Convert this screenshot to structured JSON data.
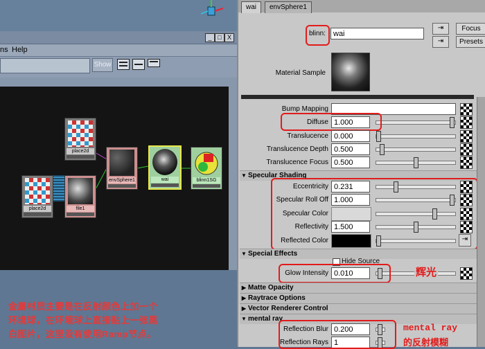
{
  "hypershade": {
    "menu_help": "Help",
    "menu_partial": "ns",
    "show_label": "Show",
    "title_buttons": [
      "_",
      "□",
      "X"
    ],
    "nodes": [
      {
        "key": "place2d_top",
        "label": "place2d"
      },
      {
        "key": "place2d_bottom",
        "label": "place2d"
      },
      {
        "key": "file1",
        "label": "file1"
      },
      {
        "key": "envSphere1",
        "label": "envSphere1"
      },
      {
        "key": "wai",
        "label": "wai"
      },
      {
        "key": "blinnSG",
        "label": "blinn1SG"
      }
    ],
    "note_line1": "金屬材质主要是在反射颜色上加一个",
    "note_line2": "环境球，在环境球上直接贴上一张黑",
    "note_line3": "白图片，这里没有使用Ramp节点。"
  },
  "attribute_editor": {
    "tabs": [
      "wai",
      "envSphere1"
    ],
    "type_label": "blinn:",
    "name_value": "wai",
    "focus_label": "Focus",
    "presets_label": "Presets",
    "material_sample_label": "Material Sample",
    "rows_top": [
      {
        "label": "Bump Mapping",
        "value": "",
        "slider": null
      },
      {
        "label": "Diffuse",
        "value": "1.000",
        "slider": 0.98
      },
      {
        "label": "Translucence",
        "value": "0.000",
        "slider": 0.0
      },
      {
        "label": "Translucence Depth",
        "value": "0.500",
        "slider": 0.05
      },
      {
        "label": "Translucence Focus",
        "value": "0.500",
        "slider": 0.5
      }
    ],
    "section_specular": "Specular Shading",
    "rows_specular": [
      {
        "label": "Eccentricity",
        "value": "0.231",
        "slider": 0.23
      },
      {
        "label": "Specular Roll Off",
        "value": "1.000",
        "slider": 0.98
      },
      {
        "label": "Specular Color",
        "value": "",
        "slider": 0.75
      },
      {
        "label": "Reflectivity",
        "value": "1.500",
        "slider": 0.5
      },
      {
        "label": "Reflected Color",
        "value": "",
        "slider": 0.0
      }
    ],
    "section_special": "Special Effects",
    "hide_source_label": "Hide Source",
    "glow_label": "Glow Intensity",
    "glow_value": "0.010",
    "glow_note": "辉光",
    "sections_collapsed": [
      "Matte Opacity",
      "Raytrace Options",
      "Vector Renderer Control"
    ],
    "section_mental": "mental ray",
    "reflection_blur_label": "Reflection Blur",
    "reflection_blur_value": "0.200",
    "reflection_rays_label": "Reflection Rays",
    "reflection_rays_value": "1",
    "mental_note_1": "mental ray",
    "mental_note_2": "的反射模糊"
  },
  "colors": {
    "annotation_red": "#e21b1b",
    "viewport_blue": "#5f7792",
    "panel_grey": "#c8c8c8"
  }
}
